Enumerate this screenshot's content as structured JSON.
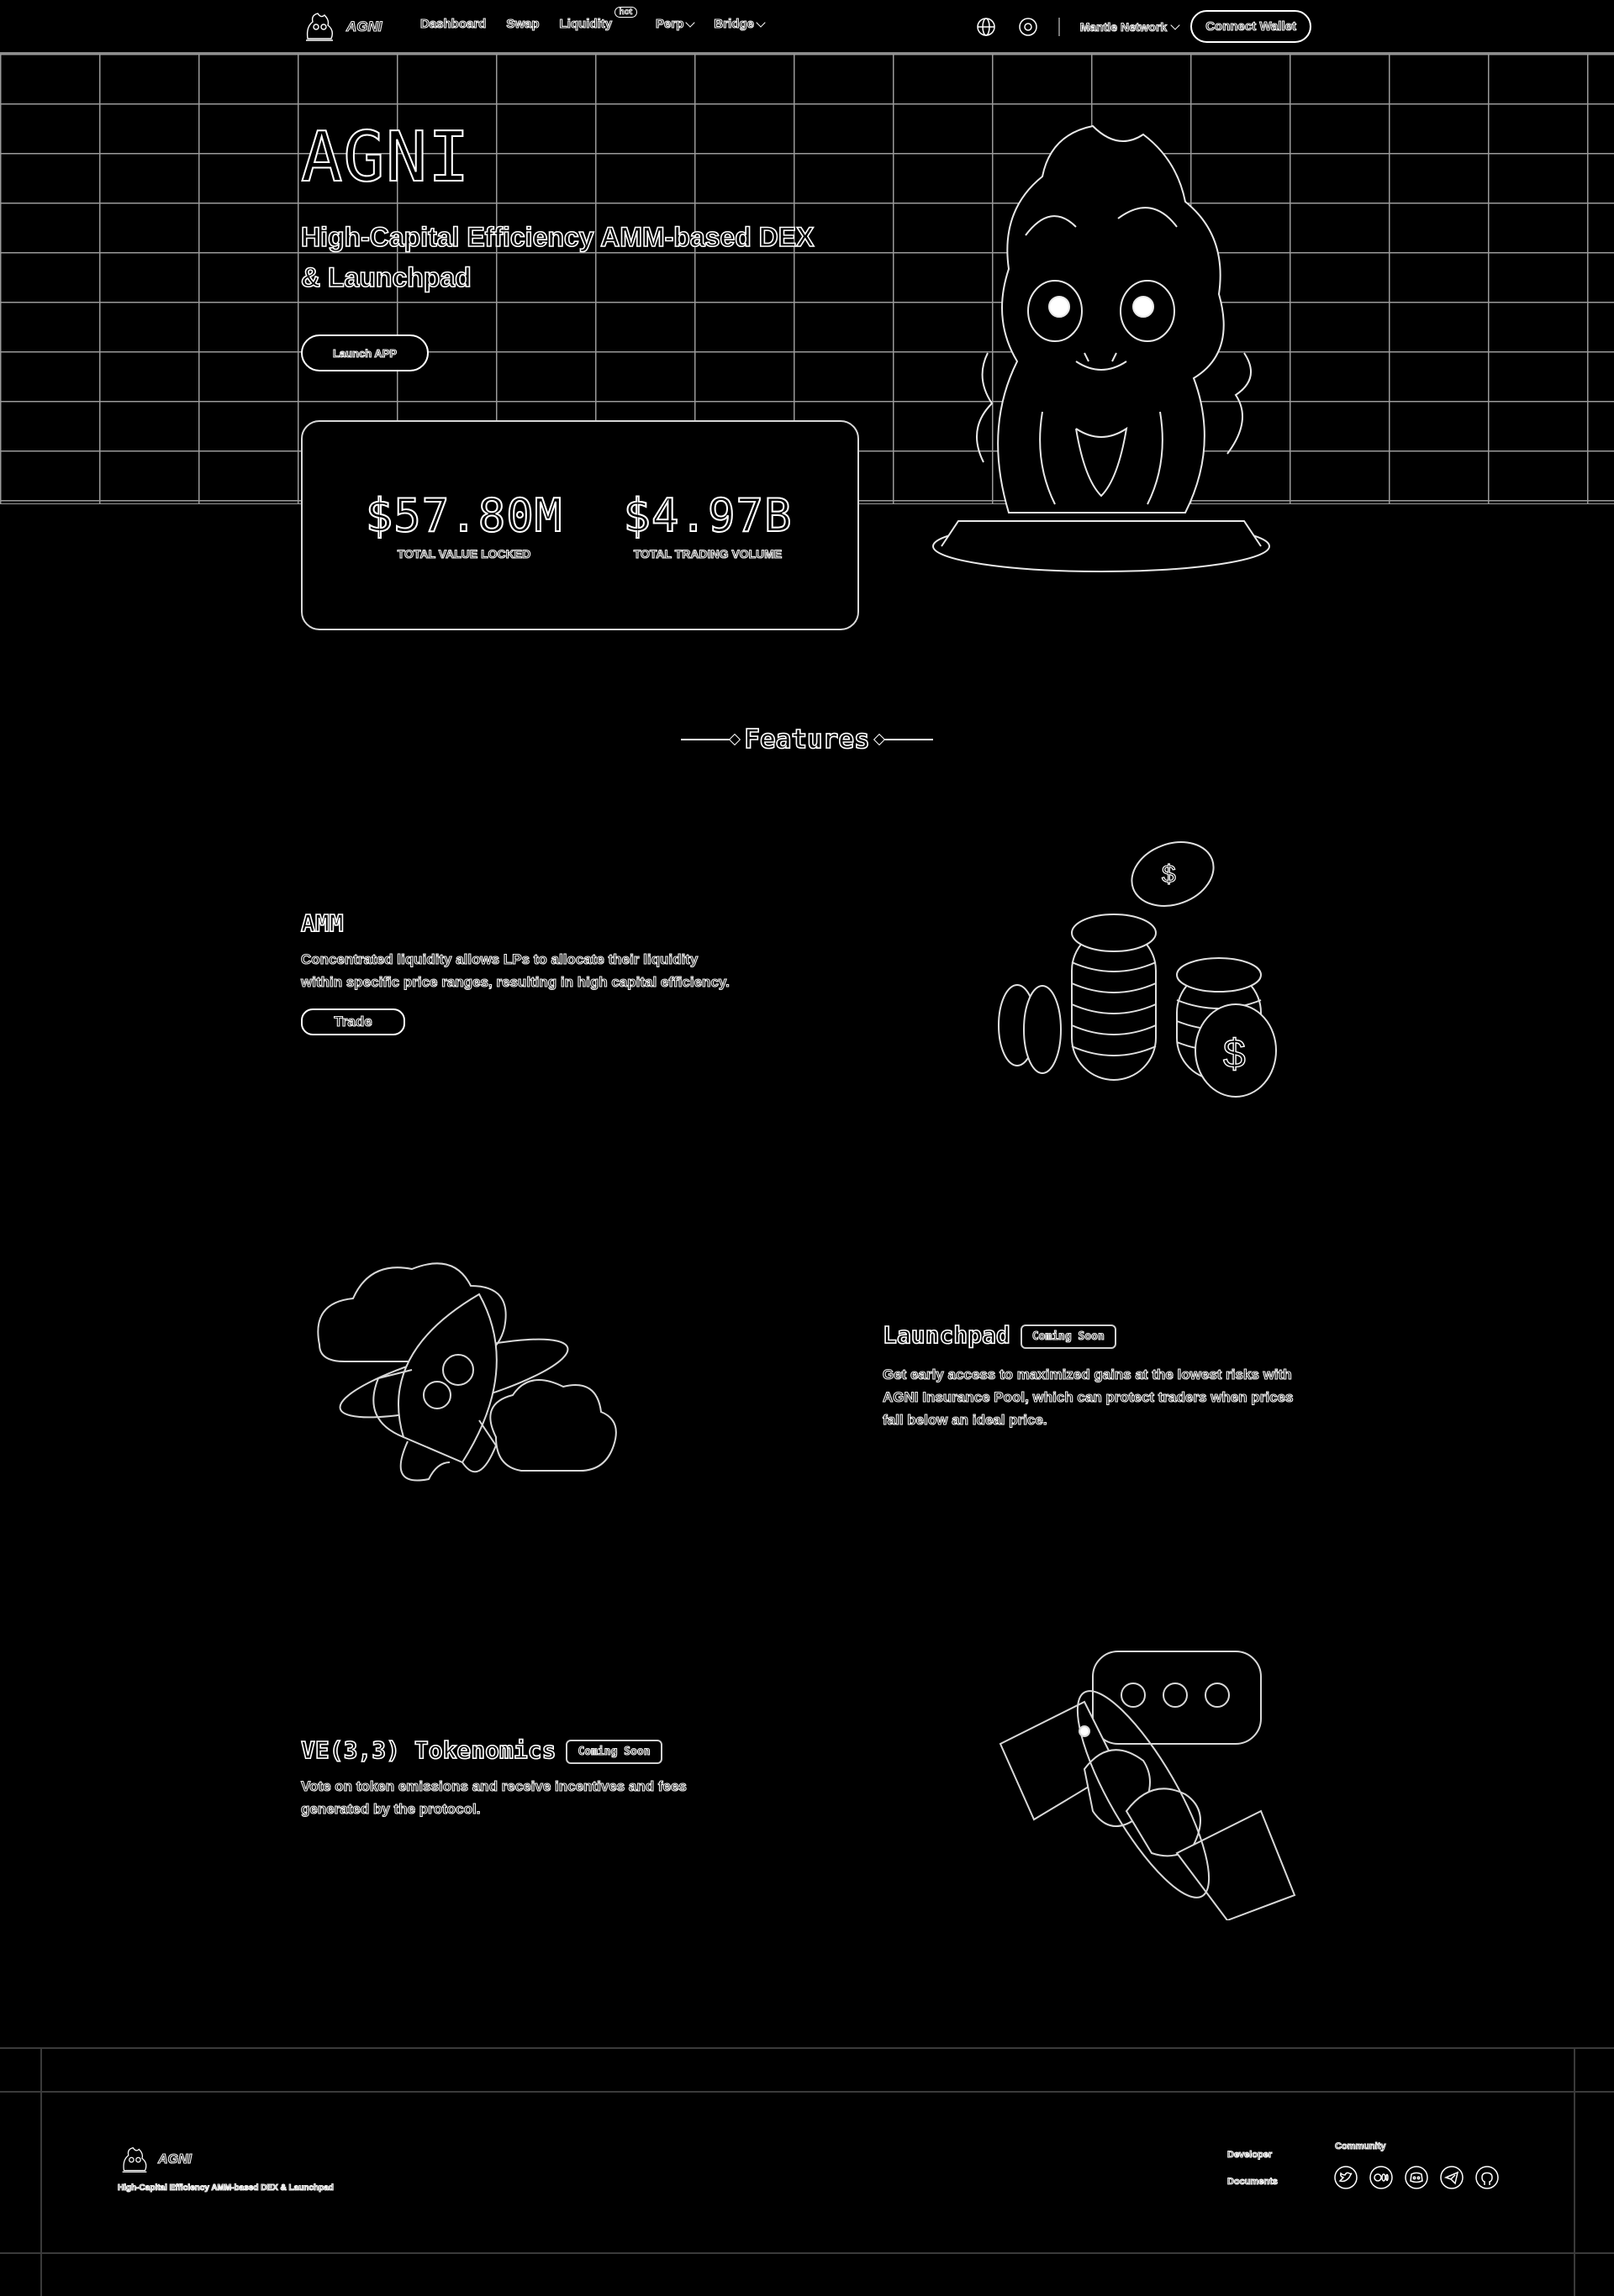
{
  "nav": {
    "logo_text": "AGNI",
    "links": [
      {
        "label": "Dashboard",
        "dropdown": false
      },
      {
        "label": "Swap",
        "dropdown": false
      },
      {
        "label": "Liquidity",
        "dropdown": false,
        "badge": "hot"
      },
      {
        "label": "Perp",
        "dropdown": true
      },
      {
        "label": "Bridge",
        "dropdown": true
      }
    ],
    "icons": [
      "globe-icon",
      "settings-icon"
    ],
    "network": "Mantle Network",
    "connect": "Connect Wallet"
  },
  "hero": {
    "title": "AGNI",
    "subtitle": "High-Capital Efficiency AMM-based DEX & Launchpad",
    "launch_button": "Launch APP",
    "stats": [
      {
        "value": "$57.80M",
        "label": "TOTAL VALUE LOCKED"
      },
      {
        "value": "$4.97B",
        "label": "TOTAL TRADING VOLUME"
      }
    ]
  },
  "features": {
    "heading": "Features",
    "items": [
      {
        "title": "AMM",
        "description": "Concentrated liquidity allows LPs to allocate their liquidity within specific price ranges, resulting in high capital efficiency.",
        "button": "Trade"
      },
      {
        "title": "Launchpad",
        "badge": "Coming Soon",
        "description": "Get early access to maximized gains at the lowest risks with AGNI Insurance Pool, which can protect traders when prices fall below an ideal price."
      },
      {
        "title": "VE(3,3) Tokenomics",
        "badge": "Coming Soon",
        "description": "Vote on token emissions and receive incentives and fees generated by the protocol."
      }
    ]
  },
  "footer": {
    "logo_text": "AGNI",
    "tagline": "High-Capital Efficiency AMM-based DEX & Launchpad",
    "developer_heading": "Developer",
    "developer_links": [
      "Documents"
    ],
    "community_heading": "Community",
    "socials": [
      "twitter-icon",
      "medium-icon",
      "discord-icon",
      "telegram-icon",
      "github-icon"
    ]
  }
}
